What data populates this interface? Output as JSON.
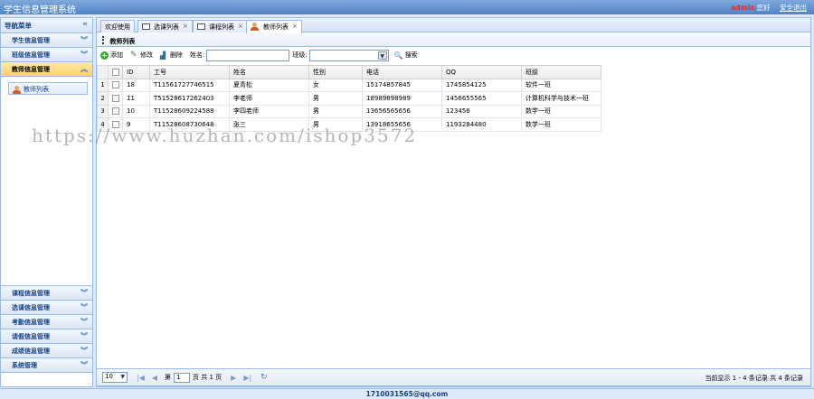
{
  "app": {
    "title": "学生信息管理系统"
  },
  "topbar": {
    "user": "admin",
    "greeting": "您好",
    "logout": "安全退出"
  },
  "sidebar": {
    "header": "导航菜单",
    "top_items": [
      {
        "label": "学生信息管理"
      },
      {
        "label": "班级信息管理"
      },
      {
        "label": "教师信息管理"
      }
    ],
    "active_child": "教师列表",
    "bottom_items": [
      {
        "label": "课程信息管理"
      },
      {
        "label": "选课信息管理"
      },
      {
        "label": "考勤信息管理"
      },
      {
        "label": "请假信息管理"
      },
      {
        "label": "成绩信息管理"
      },
      {
        "label": "系统管理"
      }
    ]
  },
  "tabs": [
    {
      "label": "欢迎使用"
    },
    {
      "label": "选课列表"
    },
    {
      "label": "课程列表"
    },
    {
      "label": "教师列表"
    }
  ],
  "panel": {
    "title": "教师列表"
  },
  "toolbar": {
    "add": "添加",
    "edit": "修改",
    "delete": "删除",
    "name_label": "姓名:",
    "name_value": "",
    "class_label": "班级:",
    "class_value": "",
    "search": "搜索"
  },
  "table": {
    "headers": [
      "ID",
      "工号",
      "姓名",
      "性别",
      "电话",
      "QQ",
      "班级"
    ],
    "rows": [
      {
        "n": "1",
        "id": "18",
        "no": "T11561727746515",
        "name": "夏青松",
        "sex": "女",
        "phone": "15174857845",
        "qq": "1745854125",
        "cls": "软件一班"
      },
      {
        "n": "2",
        "id": "11",
        "no": "T51528617262403",
        "name": "李老师",
        "sex": "男",
        "phone": "18989898989",
        "qq": "1456655565",
        "cls": "计算机科学与技术一班"
      },
      {
        "n": "3",
        "id": "10",
        "no": "T11528609224588",
        "name": "李四老师",
        "sex": "男",
        "phone": "13656565656",
        "qq": "123456",
        "cls": "数学一班"
      },
      {
        "n": "4",
        "id": "9",
        "no": "T11528608730648",
        "name": "张三",
        "sex": "男",
        "phone": "13918655656",
        "qq": "1193284480",
        "cls": "数学一班"
      }
    ]
  },
  "watermark": "https://www.huzhan.com/ishop3572",
  "pager": {
    "page_size": "10",
    "page_prefix": "第",
    "page_value": "1",
    "page_suffix": "页 共 1 页",
    "info": "当前显示 1 - 4 条记录 共 4 条记录"
  },
  "footer": {
    "email": "1710031565@qq.com"
  }
}
